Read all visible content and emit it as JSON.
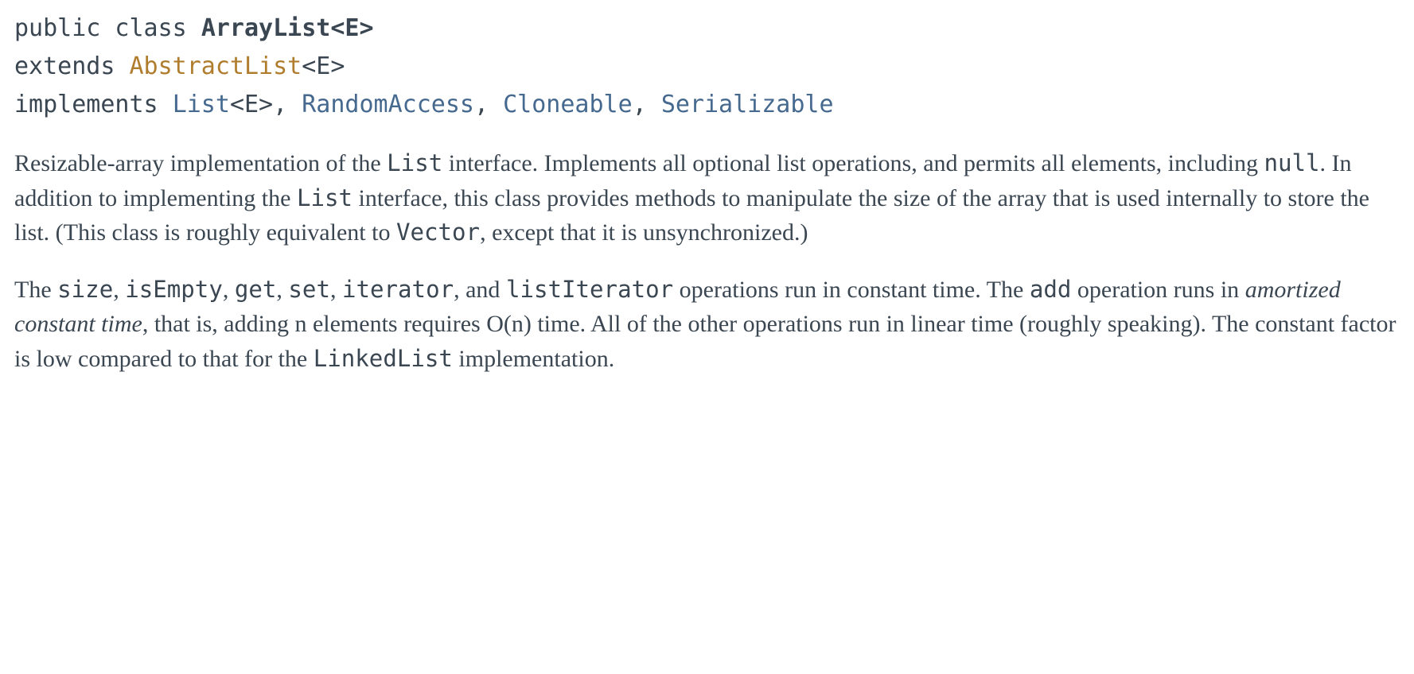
{
  "signature": {
    "prefix": "public class ",
    "class_name": "ArrayList<E>",
    "extends_keyword": "extends ",
    "superclass": "AbstractList",
    "superclass_generic": "<E>",
    "implements_keyword": "implements ",
    "interfaces": {
      "i0": "List",
      "i0_generic": "<E>",
      "sep0": ", ",
      "i1": "RandomAccess",
      "sep1": ", ",
      "i2": "Cloneable",
      "sep2": ", ",
      "i3": "Serializable"
    }
  },
  "para1": {
    "t0": "Resizable-array implementation of the ",
    "c0": "List",
    "t1": " interface. Implements all optional list operations, and permits all elements, including ",
    "c1": "null",
    "t2": ". In addition to implementing the ",
    "c2": "List",
    "t3": " interface, this class provides methods to manipulate the size of the array that is used internally to store the list. (This class is roughly equivalent to ",
    "c3": "Vector",
    "t4": ", except that it is unsynchronized.)"
  },
  "para2": {
    "t0": "The ",
    "c0": "size",
    "t1": ", ",
    "c1": "isEmpty",
    "t2": ", ",
    "c2": "get",
    "t3": ", ",
    "c3": "set",
    "t4": ", ",
    "c4": "iterator",
    "t5": ", and ",
    "c5": "listIterator",
    "t6": " operations run in constant time. The ",
    "c6": "add",
    "t7": " operation runs in ",
    "em0": "amortized constant time",
    "t8": ", that is, adding n elements requires O(n) time. All of the other operations run in linear time (roughly speaking). The constant factor is low compared to that for the ",
    "c7": "LinkedList",
    "t9": " implementation."
  }
}
